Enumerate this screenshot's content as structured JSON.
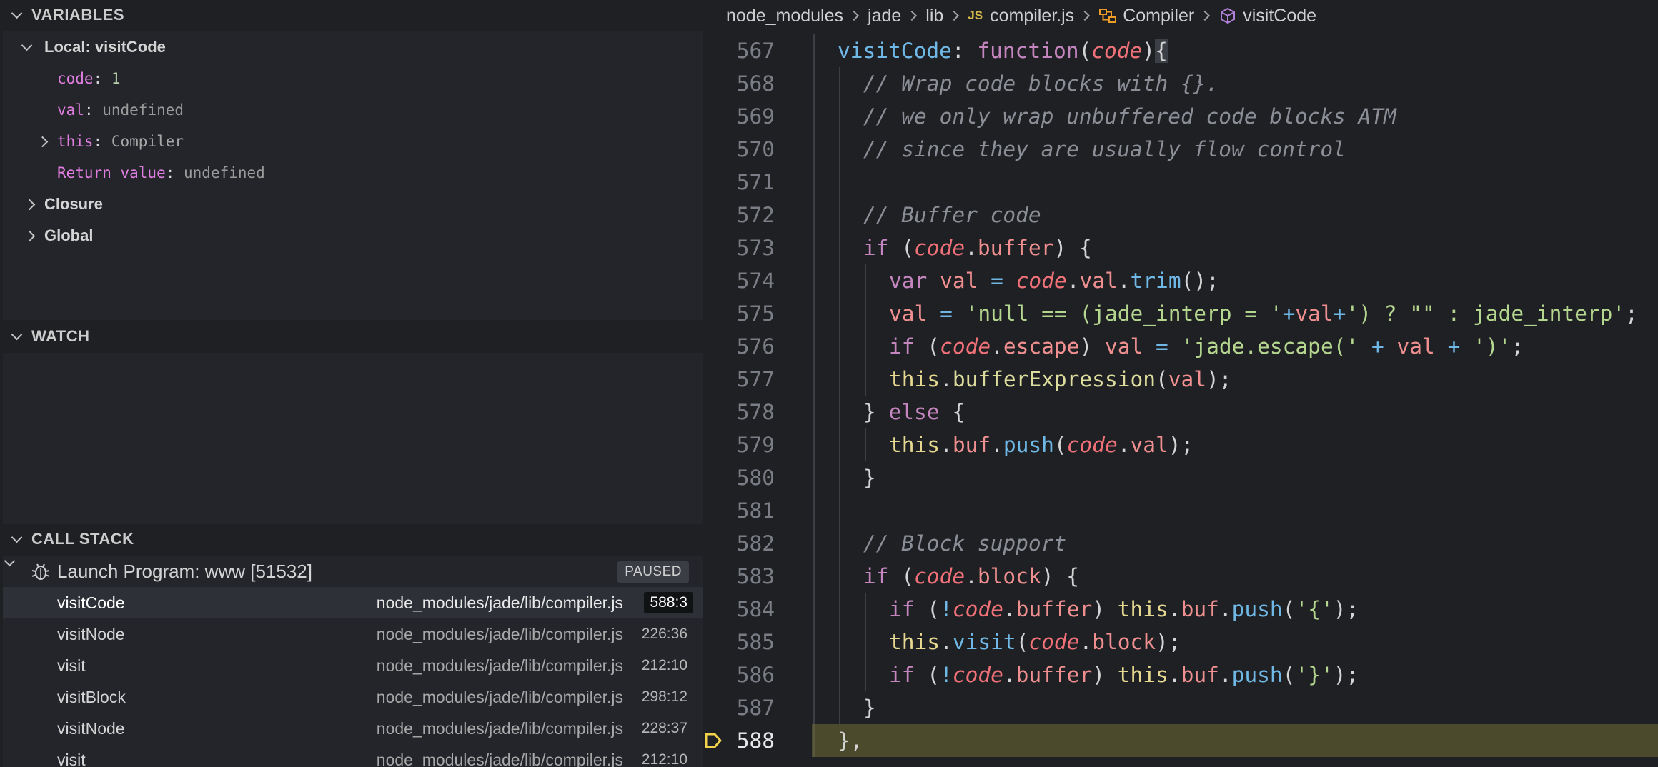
{
  "variables": {
    "title": "VARIABLES",
    "local_scope": "Local: visitCode",
    "items": [
      {
        "name": "code",
        "value": "1"
      },
      {
        "name": "val",
        "value": "undefined"
      },
      {
        "name": "this",
        "value": "Compiler"
      },
      {
        "name": "Return value",
        "value": "undefined"
      }
    ],
    "closure": "Closure",
    "global": "Global"
  },
  "watch": {
    "title": "WATCH"
  },
  "call_stack": {
    "title": "CALL STACK",
    "thread": "Launch Program: www [51532]",
    "status": "PAUSED",
    "frames": [
      {
        "name": "visitCode",
        "path": "node_modules/jade/lib/compiler.js",
        "pos": "588:3"
      },
      {
        "name": "visitNode",
        "path": "node_modules/jade/lib/compiler.js",
        "pos": "226:36"
      },
      {
        "name": "visit",
        "path": "node_modules/jade/lib/compiler.js",
        "pos": "212:10"
      },
      {
        "name": "visitBlock",
        "path": "node_modules/jade/lib/compiler.js",
        "pos": "298:12"
      },
      {
        "name": "visitNode",
        "path": "node_modules/jade/lib/compiler.js",
        "pos": "228:37"
      },
      {
        "name": "visit",
        "path": "node_modules/jade/lib/compiler.js",
        "pos": "212:10"
      }
    ]
  },
  "breadcrumb": {
    "items": [
      "node_modules",
      "jade",
      "lib",
      "compiler.js",
      "Compiler",
      "visitCode"
    ],
    "js_badge": "JS"
  },
  "editor": {
    "current_line": "588",
    "line_numbers": [
      "567",
      "568",
      "569",
      "570",
      "571",
      "572",
      "573",
      "574",
      "575",
      "576",
      "577",
      "578",
      "579",
      "580",
      "581",
      "582",
      "583",
      "584",
      "585",
      "586",
      "587",
      "588"
    ]
  },
  "colors": {
    "background": "#1f2024",
    "current_line_highlight": "#4b4a2c",
    "breakpoint": "#f2d24b"
  }
}
